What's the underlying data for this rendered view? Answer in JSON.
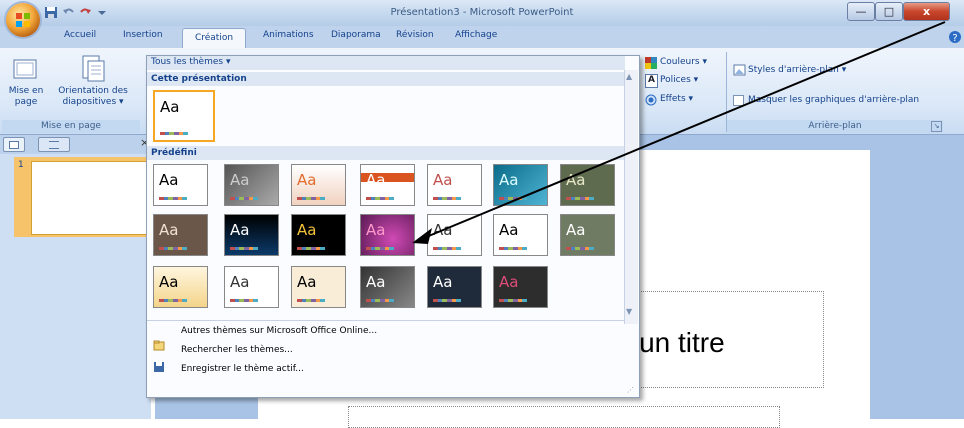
{
  "window": {
    "title": "Présentation3 - Microsoft PowerPoint",
    "minimize_glyph": "—",
    "maximize_glyph": "□",
    "close_glyph": "x"
  },
  "ribbon_tabs": [
    "Accueil",
    "Insertion",
    "Création",
    "Animations",
    "Diaporama",
    "Révision",
    "Affichage"
  ],
  "active_tab": "Création",
  "page_setup_group": {
    "btn_setup_line1": "Mise en",
    "btn_setup_line2": "page",
    "btn_orientation_line1": "Orientation des",
    "btn_orientation_line2": "diapositives ▾",
    "group_label": "Mise en page"
  },
  "theme_options": {
    "colors": "Couleurs ▾",
    "fonts": "Polices ▾",
    "effects": "Effets ▾"
  },
  "background_group": {
    "styles": "Styles d'arrière-plan ▾",
    "hide_graphics": "Masquer les graphiques d'arrière-plan",
    "group_label": "Arrière-plan"
  },
  "gallery": {
    "header_dropdown": "Tous les thèmes ▾",
    "section_current": "Cette présentation",
    "section_builtin": "Prédéfini",
    "thumb_text": "Aa",
    "menu": [
      "Autres thèmes sur Microsoft Office Online...",
      "Rechercher les thèmes...",
      "Enregistrer le thème actif..."
    ]
  },
  "slide": {
    "title_placeholder_fragment": "r un titre"
  },
  "slide_panel": {
    "slide_number": "1",
    "close_glyph": "×"
  },
  "colors": {
    "accent_blue": "#15428b",
    "ribbon_bg": "#d9e7f7",
    "selected_theme_border": "#f5a623"
  }
}
